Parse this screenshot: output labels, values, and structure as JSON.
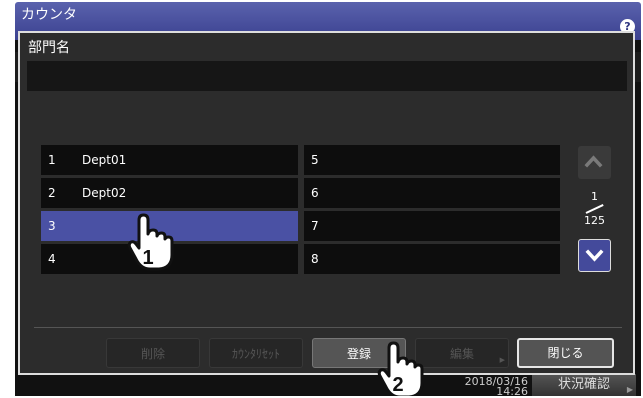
{
  "app": {
    "title": "カウンタ",
    "help_icon": "?",
    "footer_time": "2018/03/16\n14:26",
    "status_button": "状況確認",
    "status_arrow": "▶"
  },
  "dialog": {
    "title": "部門名",
    "name_value": "",
    "page_current": "1",
    "page_total": "125",
    "left_column": [
      {
        "num": "1",
        "name": "Dept01"
      },
      {
        "num": "2",
        "name": "Dept02"
      },
      {
        "num": "3",
        "name": ""
      },
      {
        "num": "4",
        "name": ""
      }
    ],
    "right_column": [
      {
        "num": "5",
        "name": ""
      },
      {
        "num": "6",
        "name": ""
      },
      {
        "num": "7",
        "name": ""
      },
      {
        "num": "8",
        "name": ""
      }
    ],
    "buttons": {
      "delete": "削除",
      "counter_reset": "ｶｳﾝﾀﾘｾｯﾄ",
      "register": "登録",
      "edit": "編集",
      "close": "閉じる"
    },
    "submenu_arrow": "▶"
  },
  "callouts": {
    "step1": "1",
    "step2": "2"
  },
  "colors": {
    "header": "#3b4190",
    "selected_row": "#4a51a4",
    "dialog_bg": "#2c2c2c"
  }
}
